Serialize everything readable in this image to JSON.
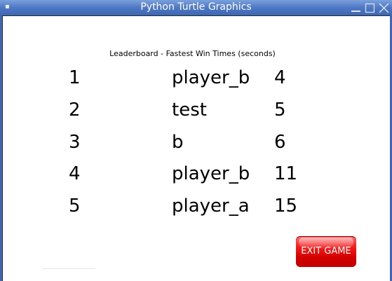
{
  "window": {
    "title": "Python Turtle Graphics"
  },
  "leaderboard": {
    "title": "Leaderboard - Fastest Win Times (seconds)",
    "rows": [
      {
        "rank": "1",
        "name": "player_b",
        "time": "4"
      },
      {
        "rank": "2",
        "name": "test",
        "time": "5"
      },
      {
        "rank": "3",
        "name": "b",
        "time": "6"
      },
      {
        "rank": "4",
        "name": "player_b",
        "time": "11"
      },
      {
        "rank": "5",
        "name": "player_a",
        "time": "15"
      }
    ]
  },
  "exit_button": {
    "label": "EXIT GAME"
  },
  "colors": {
    "titlebar": "#4e78c4",
    "exit_button": "#e00000",
    "text": "#000000"
  },
  "icons": {
    "window_menu": "window-menu-icon",
    "minimize": "minimize-icon",
    "maximize": "maximize-icon",
    "close": "close-icon"
  }
}
